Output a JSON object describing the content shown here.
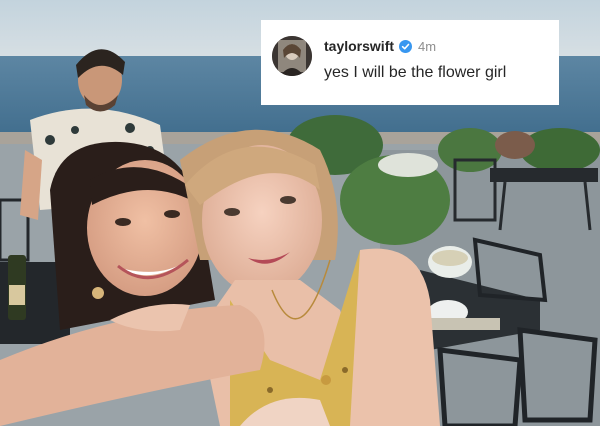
{
  "comment": {
    "username": "taylorswift",
    "verified": true,
    "time": "4m",
    "text": "yes I will be the flower girl",
    "verified_icon": "verified-badge-icon",
    "accent_color": "#3897f0"
  },
  "photo": {
    "description_icon": "selfie-photo",
    "sky_color": "#c8d6df",
    "sea_color": "#4f7a98"
  }
}
